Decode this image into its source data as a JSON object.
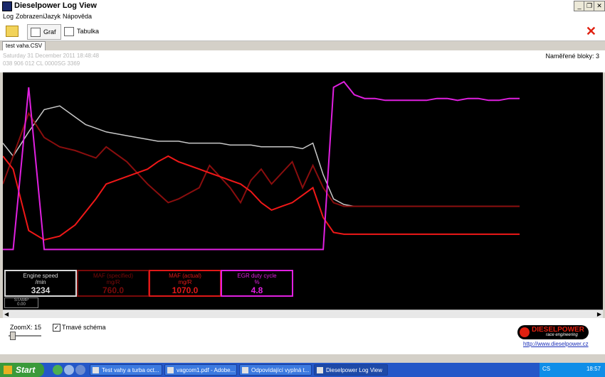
{
  "window": {
    "title": "Dieselpower Log View",
    "controls": {
      "minimize": "_",
      "restore": "❐",
      "close": "✕"
    }
  },
  "menu": [
    "Log",
    "Zobrazení",
    "Jazyk",
    "Nápověda"
  ],
  "toolbar": {
    "graph_tab": "Graf",
    "table_tab": "Tabulka",
    "open_icon": "folder-open-icon",
    "close_icon": "close-icon"
  },
  "file_tab": "test vaha.CSV",
  "info": {
    "date": "Saturday 31 December 2011 18:48:48",
    "ecu": "038 906 012 CL  0000SG  3369",
    "blocks_label": "Naměřené bloky: 3"
  },
  "gauges": [
    {
      "name": "Engine speed",
      "unit": "/min",
      "value": "3234",
      "color": "#d8d8d8"
    },
    {
      "name": "MAF (specified)",
      "unit": "mg/R",
      "value": "760.0",
      "color": "#7a0a0a"
    },
    {
      "name": "MAF (actual)",
      "unit": "mg/R",
      "value": "1070.0",
      "color": "#e01818"
    },
    {
      "name": "EGR duty cycle",
      "unit": "%",
      "value": "4.8",
      "color": "#e020e0"
    }
  ],
  "stamp": {
    "label": "STAMP",
    "value": "0.00"
  },
  "bottom": {
    "zoom_label": "ZoomX: 15",
    "dark_scheme_label": "Tmavé schéma",
    "dark_scheme_checked": "✓",
    "logo_name": "DIESELPOWER",
    "logo_sub": "race engineering",
    "website": "http://www.dieselpower.cz"
  },
  "taskbar": {
    "start": "Start",
    "tasks": [
      "Test vahy a turba oct...",
      "vagcom1.pdf - Adobe...",
      "Odpovídající vyplná t...",
      "Dieselpower Log View"
    ],
    "lang": "CS",
    "clock": "18:57"
  },
  "chart_data": {
    "type": "line",
    "x": [
      0,
      2,
      5,
      8,
      11,
      14,
      16,
      18,
      20,
      24,
      28,
      30,
      32,
      34,
      36,
      38,
      40,
      42,
      44,
      46,
      48,
      50,
      52,
      54,
      56,
      58,
      60,
      62,
      64,
      66,
      68,
      70,
      72,
      74,
      76,
      78,
      80,
      82,
      84,
      86,
      88,
      90,
      92,
      94,
      96,
      98,
      100
    ],
    "series": [
      {
        "name": "Engine speed",
        "color": "#c8c8c8",
        "values": [
          62,
          55,
          68,
          80,
          82,
          76,
          72,
          70,
          68,
          66,
          64,
          63,
          63,
          63,
          62,
          62,
          62,
          62,
          61,
          61,
          61,
          60,
          60,
          60,
          60,
          59,
          62,
          45,
          32,
          29,
          28,
          28,
          28,
          28,
          28,
          28,
          28,
          28,
          28,
          28,
          28,
          28,
          28,
          28,
          28,
          28,
          28
        ]
      },
      {
        "name": "MAF (specified)",
        "color": "#8a0e0e",
        "values": [
          40,
          55,
          78,
          65,
          60,
          58,
          56,
          54,
          60,
          52,
          40,
          35,
          30,
          32,
          35,
          38,
          50,
          44,
          38,
          30,
          42,
          48,
          40,
          46,
          52,
          38,
          50,
          38,
          30,
          28,
          28,
          28,
          28,
          28,
          28,
          28,
          28,
          28,
          28,
          28,
          28,
          28,
          28,
          28,
          28,
          28,
          28
        ]
      },
      {
        "name": "MAF (actual)",
        "color": "#f01818",
        "values": [
          55,
          48,
          15,
          10,
          12,
          18,
          25,
          32,
          40,
          44,
          48,
          52,
          55,
          52,
          50,
          48,
          46,
          44,
          42,
          40,
          36,
          30,
          26,
          28,
          30,
          34,
          38,
          22,
          14,
          13,
          13,
          13,
          13,
          13,
          13,
          13,
          13,
          13,
          13,
          13,
          13,
          13,
          13,
          13,
          13,
          13,
          13
        ]
      },
      {
        "name": "EGR duty cycle",
        "color": "#e020e0",
        "values": [
          4.8,
          4.8,
          92,
          4.8,
          4.8,
          4.8,
          4.8,
          4.8,
          4.8,
          4.8,
          4.8,
          4.8,
          4.8,
          4.8,
          4.8,
          4.8,
          4.8,
          4.8,
          4.8,
          4.8,
          4.8,
          4.8,
          4.8,
          4.8,
          4.8,
          4.8,
          4.8,
          4.8,
          92,
          95,
          88,
          86,
          86,
          85,
          85,
          85,
          85,
          85,
          86,
          86,
          85,
          86,
          86,
          85,
          85,
          86,
          86
        ]
      }
    ]
  }
}
